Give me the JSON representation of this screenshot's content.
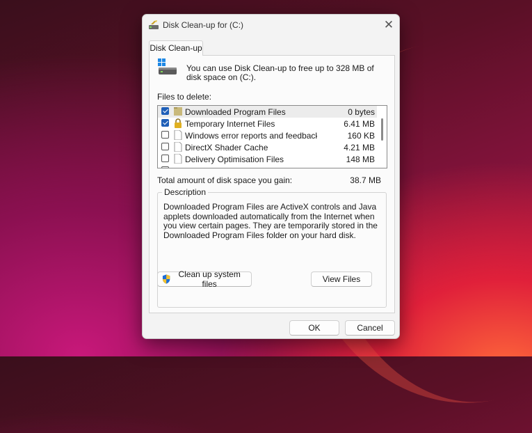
{
  "window": {
    "title": "Disk Clean-up for  (C:)"
  },
  "tab": {
    "label": "Disk Clean-up"
  },
  "intro": "You can use Disk Clean-up to free up to 328 MB of disk space on  (C:).",
  "files_label": "Files to delete:",
  "files": [
    {
      "name": "Downloaded Program Files",
      "size": "0 bytes",
      "checked": true,
      "icon": "folder-icon",
      "selected": true
    },
    {
      "name": "Temporary Internet Files",
      "size": "6.41 MB",
      "checked": true,
      "icon": "lock-icon",
      "selected": false
    },
    {
      "name": "Windows error reports and feedback di...",
      "size": "160 KB",
      "checked": false,
      "icon": "file-icon",
      "selected": false
    },
    {
      "name": "DirectX Shader Cache",
      "size": "4.21 MB",
      "checked": false,
      "icon": "file-icon",
      "selected": false
    },
    {
      "name": "Delivery Optimisation Files",
      "size": "148 MB",
      "checked": false,
      "icon": "file-icon",
      "selected": false
    }
  ],
  "total": {
    "label": "Total amount of disk space you gain:",
    "value": "38.7 MB"
  },
  "description": {
    "legend": "Description",
    "text": "Downloaded Program Files are ActiveX controls and Java applets downloaded automatically from the Internet when you view certain pages. They are temporarily stored in the Downloaded Program Files folder on your hard disk."
  },
  "buttons": {
    "cleanup_system": "Clean up system files",
    "view_files": "View Files",
    "ok": "OK",
    "cancel": "Cancel"
  },
  "colors": {
    "checkbox_accent": "#1f5fb8",
    "dialog_bg": "#f3f3f3"
  }
}
